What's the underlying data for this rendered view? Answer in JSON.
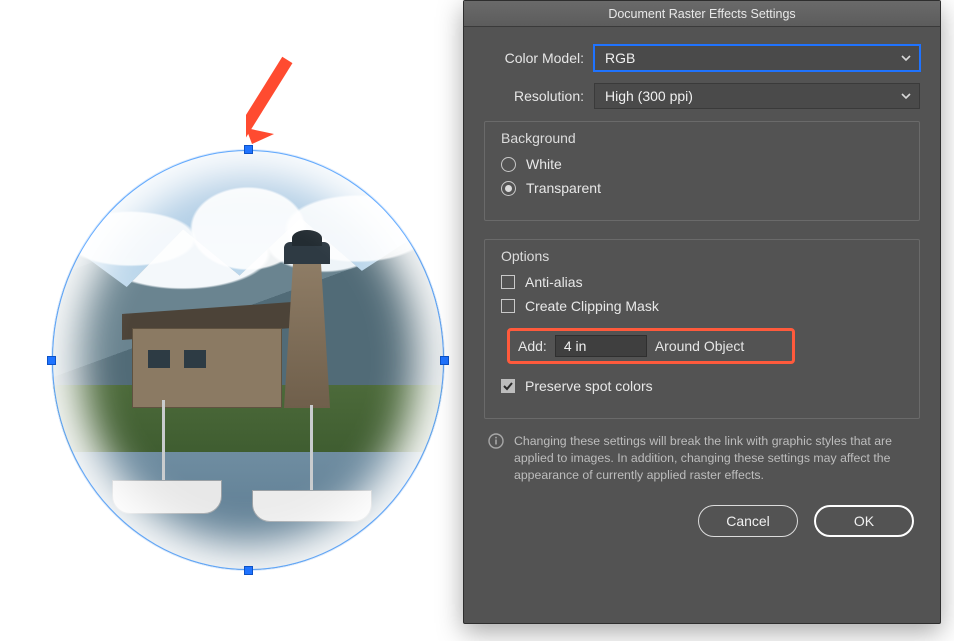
{
  "annotation": {
    "arrow_color": "#ff4b30"
  },
  "dialog": {
    "title": "Document Raster Effects Settings",
    "color_model": {
      "label": "Color Model:",
      "value": "RGB"
    },
    "resolution": {
      "label": "Resolution:",
      "value": "High (300 ppi)"
    },
    "background": {
      "title": "Background",
      "white_label": "White",
      "transparent_label": "Transparent",
      "selected": "transparent"
    },
    "options": {
      "title": "Options",
      "anti_alias": {
        "label": "Anti-alias",
        "checked": false
      },
      "clipping_mask": {
        "label": "Create Clipping Mask",
        "checked": false
      },
      "add": {
        "label": "Add:",
        "value": "4 in",
        "suffix": "Around Object"
      },
      "preserve_spot": {
        "label": "Preserve spot colors",
        "checked": true
      }
    },
    "note": "Changing these settings will break the link with graphic styles that are applied to images. In addition, changing these settings may affect the appearance of currently applied raster effects.",
    "buttons": {
      "cancel": "Cancel",
      "ok": "OK"
    }
  },
  "highlight": {
    "color": "#ff5a3c"
  }
}
